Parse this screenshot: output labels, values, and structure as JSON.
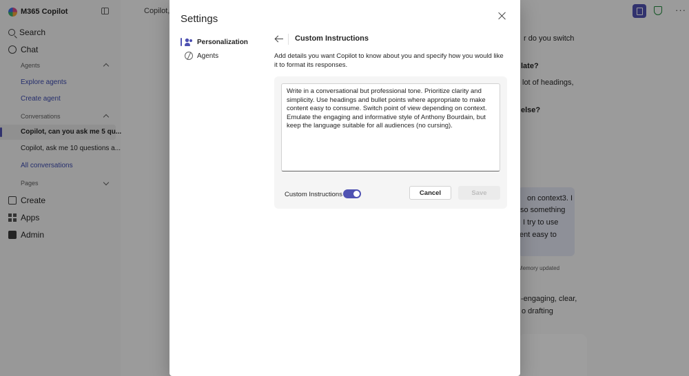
{
  "app": {
    "title": "M365 Copilot",
    "nav": {
      "search": "Search",
      "chat": "Chat",
      "create": "Create",
      "apps": "Apps",
      "admin": "Admin"
    },
    "sections": {
      "agents": "Agents",
      "conversations": "Conversations",
      "pages": "Pages"
    },
    "agent_items": [
      "Explore agents",
      "Create agent"
    ],
    "conversation_items": [
      "Copilot, can you ask me 5 qu...",
      "Copilot, ask me 10 questions a..."
    ],
    "all_conversations": "All conversations"
  },
  "header": {
    "conversation_title": "Copilot, c"
  },
  "background_chat": {
    "lines": [
      "r do you switch",
      "late?",
      "lot of headings,",
      "else?",
      "on context3. I",
      "so something",
      "I try to use",
      "ent easy to",
      "Memory updated",
      "-engaging, clear,",
      "o drafting"
    ]
  },
  "dialog": {
    "title": "Settings",
    "menu": {
      "personalization": "Personalization",
      "agents": "Agents"
    },
    "panel": {
      "title": "Custom Instructions",
      "description": "Add details you want Copilot to know about you and specify how you would like it to format its responses.",
      "instructions_text": "Write in a conversational but professional tone. Prioritize clarity and simplicity. Use headings and bullet points where appropriate to make content easy to consume. Switch point of view depending on context. Emulate the engaging and informative style of Anthony Bourdain, but keep the language suitable for all audiences (no cursing).",
      "toggle_label": "Custom Instructions",
      "toggle_on": true,
      "cancel_label": "Cancel",
      "save_label": "Save"
    }
  },
  "colors": {
    "accent": "#4f52b2",
    "link": "#3d4bb0",
    "overlay": "rgba(0,0,0,0.38)",
    "shield": "#1f8a3b"
  }
}
